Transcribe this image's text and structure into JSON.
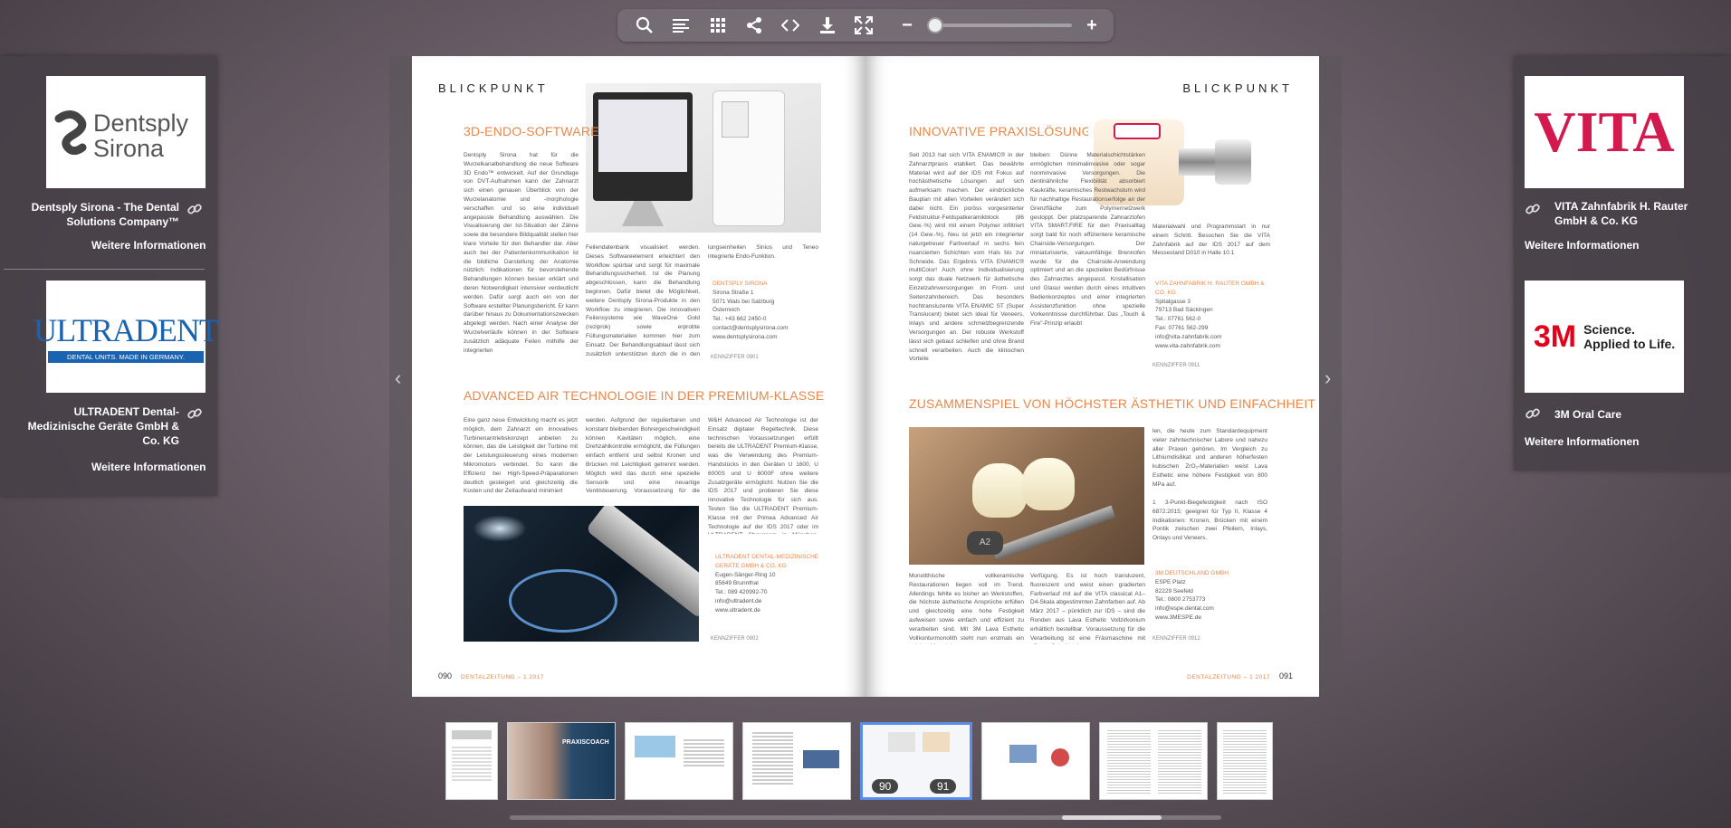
{
  "toolbar": {
    "buttons": [
      "search-icon",
      "toc-icon",
      "grid-icon",
      "share-icon",
      "embed-icon",
      "download-icon",
      "fullscreen-icon"
    ],
    "zoom_out": "−",
    "zoom_in": "+",
    "zoom_level": 0
  },
  "left_panel": {
    "sponsors": [
      {
        "logo_text_1": "Dentsply",
        "logo_text_2": "Sirona",
        "name": "Dentsply Sirona - The Dental Solutions Company™",
        "more": "Weitere Informationen"
      },
      {
        "logo_text_1": "ULTRADENT",
        "logo_text_2": "DENTAL UNITS. MADE IN GERMANY.",
        "name": "ULTRADENT Dental-Medizinische Geräte GmbH & Co. KG",
        "more": "Weitere Informationen"
      }
    ]
  },
  "right_panel": {
    "sponsors": [
      {
        "logo_text_1": "VITA",
        "name": "VITA Zahnfabrik H. Rauter GmbH & Co. KG",
        "more": "Weitere Informationen"
      },
      {
        "logo_text_1": "3M",
        "logo_text_2": "Science.",
        "logo_text_3": "Applied to Life.",
        "name": "3M Oral Care",
        "more": "Weitere Informationen"
      }
    ]
  },
  "left_page": {
    "kicker": "BLICKPUNKT",
    "headline_1": "3D-ENDO-SOFTWARE",
    "body_1a": "Dentsply Sirona hat für die Wurzelkanalbehandlung die neue Software 3D Endo™ entwickelt. Auf der Grundlage von DVT-Aufnahmen kann der Zahnarzt sich einen genauen Überblick von der Wurzelanatomie und -morphologie verschaffen und so eine individuell angepasste Behandlung auswählen. Die Visualisierung der Ist-Situation der Zähne sowie die besondere Bildqualität stellen hier klare Vorteile für den Behandler dar. Aber auch bei der Patientenkommunikation ist die bildliche Darstellung der Anatomie nützlich: Indikationen für bevorstehende Behandlungen können besser erklärt und deren Notwendigkeit intensiver verdeutlicht werden. Dafür sorgt auch ein von der Software erstellter Planungsbericht. Er kann darüber hinaus zu Dokumentationszwecken abgelegt werden. Nach einer Analyse der Wurzelverläufe können in der Software zusätzlich adäquate Feilen mithilfe der integrierten",
    "body_1b": "Feilendatenbank visualisiert werden. Dieses Softwareelement erleichtert den Workflow spürbar und sorgt für maximale Behandlungssicherheit. Ist die Planung abgeschlossen, kann die Behandlung beginnen. Dafür bietet die Möglichkeit, weitere Dentsply Sirona-Produkte in den Workflow zu integrieren. Die innovativen Feilensysteme wie WaveOne Gold (reziprok) sowie erprobte Füllungsmaterialien kommen hier zum Einsatz. Der Behandlungsablauf lässt sich zusätzlich unterstützen durch die in den Behand-",
    "body_1c": "lungseinheiten Sinius und Teneo integrierte Endo-Funktion.",
    "contact_1_co": "DENTSPLY SIRONA",
    "contact_1": [
      "Sirona Straße 1",
      "5071 Wals bei Salzburg",
      "Österreich",
      "Tel.: +43 662 2450-0",
      "contact@dentsplysirona.com",
      "www.dentsplysirona.com"
    ],
    "kennz_1": "KENNZIFFER 0901",
    "headline_2": "ADVANCED AIR TECHNOLOGIE IN DER PREMIUM-KLASSE",
    "body_2a": "Eine ganz neue Entwicklung macht es jetzt möglich, dem Zahnarzt ein innovatives Turbinenantriebskonzept anbieten zu können, das die Leistigkeit der Turbine mit der Leistungssteuerung eines modernen Mikromotors verbindet. So kann die Effizienz bei High-Speed-Präparationen deutlich gesteigert und gleichzeitig die Kosten und der Zeitaufwand minimiert",
    "body_2b": "werden. Aufgrund der regulierbaren und konstant bleibenden Bohrergeschwindigkeit können Kavitäten möglich, eine Drehzahlkontrolle ermöglicht, die Füllungen einfach entfernt und selbst Kronen und Brücken mit Leichtigkeit getrennt werden. Möglich wird das durch eine spezielle Sensorik und eine neuartige Ventilsteuerung. Voraussetzung für die Nutzung der",
    "body_2c": "W&H Advanced Air Technologie ist der Einsatz digitaler Regeltechnik. Diese technischen Voraussetzungen erfüllt bereits die ULTRADENT Premium-Klasse, was die Verwendung des Premium-Handstücks in den Geräten U 1600, U 6000S und U 6000F ohne weitere Zusatzgeräte ermöglicht. Nutzen Sie die IDS 2017 und probieren Sie diese innovative Technologie für sich aus. Testen Sie die ULTRADENT Premium-Klasse mit der Primea Advanced Air Technologie auf der IDS 2017 oder im ULTRADENT Showroom in München-Brunnthal.",
    "contact_2_co": "ULTRADENT DENTAL-MEDIZINISCHE GERÄTE GMBH & CO. KG",
    "contact_2": [
      "Eugen-Sänger-Ring 10",
      "85649 Brunnthal",
      "Tel.: 089 420992-70",
      "info@ultradent.de",
      "www.ultradent.de"
    ],
    "kennz_2": "KENNZIFFER 0902",
    "page_no": "090",
    "magazine": "DENTALZEITUNG – 1 2017"
  },
  "right_page": {
    "kicker": "BLICKPUNKT",
    "headline_1": "INNOVATIVE PRAXISLÖSUNGEN",
    "body_1a": "Seit 2013 hat sich VITA ENAMIC® in der Zahnarztpraxis etabliert. Das bewährte Material wird auf der IDS mit Fokus auf hochästhetische Lösungen auf sich aufmerksam machen. Der eindrückliche Bauplan mit allen Vorteilen verändert sich dabei nicht. Ein poröss vorgesinterter Feldstruktur-Feldspatkeramikblock (86 Gew.-%) wird mit einem Polymer infiltriert (14 Gew.-%). Neu ist jetzt ein integrierter naturgetreuer Farbverlauf in sechs fein nuancierten Schichten vom Hals bis zur Schneide. Das Ergebnis VITA ENAMIC® multiColor! Auch ohne Individualisierung sorgt das duale Netzwerk für ästhetische Einzelzahnversorgungen im Front- und Seitenzahnbereich. Das besonders hochtransluzente VITA ENAMIC ST (Super Translucent) bietet sich ideal für Veneers, Inlays und andere schmelzbegrenzende Versorgungen an. Der robuste Werkstoff lässt sich gebaut schleifen und ohne Brand schnell verarbeiten. Auch die klinischen Vorteile",
    "body_1b": "bleiben: Dünne Materialschichtstärken ermöglichen minimalinvasive oder sogar nonminvasive Versorgungen. Die dentinähnliche Flexibilität absorbiert Kaukräfte, keramisches Restwachstum wird für nachhaltige Restaurationserfolge an der Grenzfläche zum Polymernetzwerk gestoppt. Der platzsparende Zahnarztofen VITA SMART.FIRE für den Praxisalltag sorgt bald für noch effizientere keramische Chairside-Versorgungen. Der miniaturisierte, vakuumfähige Brennofen wurde für die Chairside-Anwendung optimiert und an die speziellen Bedürfnisse des Zahnarztes angepasst. Kristallisation und Glasur werden durch eines intuitiven Bedienkonzeptes und einer integrierten Assistenzfunktion ohne spezielle Vorkenntnisse durchführbar. Das „Touch & Fire\"-Prinzip erlaubt",
    "body_1c": "Materialwahl und Programmstart in nur einem Schritt. Besuchen Sie die VITA Zahnfabrik auf der IDS 2017 auf dem Messestand D010 in Halle 10.1",
    "contact_1_co": "VITA ZAHNFABRIK H. RAUTER GMBH & CO. KG",
    "contact_1": [
      "Spitalgasse 3",
      "79713 Bad Säckingen",
      "Tel.: 07761 562-0",
      "Fax: 07761 562-299",
      "info@vita-zahnfabrik.com",
      "www.vita-zahnfabrik.com"
    ],
    "kennz_1": "KENNZIFFER 0911",
    "headline_2": "ZUSAMMENSPIEL VON HÖCHSTER ÄSTHETIK UND EINFACHHEIT",
    "body_2_side": "len, die heute zum Standardequipment vieler zahntechnischer Labore und nahezu aller Praxen gehören. Im Vergleich zu Lithiumdisilikat und anderen höherfesten kubischen ZrO₂-Materialien weist Lava Esthetic eine höhere Festigkeit von 800 MPa auf.",
    "body_2_note": "1 3-Punkt-Biegefestigkeit nach ISO 6872:2015; geeignet für Typ II, Klasse 4 Indikationen: Kronen, Brücken mit einem Pontik zwischen zwei Pfeilern, Inlays, Onlays und Veneers.",
    "body_2a": "Monolithische vollkeramische Restaurationen liegen voll im Trend. Allerdings fehlte es bisher an Werkstoffen, die höchste ästhetische Ansprüche erfüllen und gleichzeitig eine hohe Festigkeit aufweisen sowie einfach und effizient zu verarbeiten sind. Mit 3M Lava Esthetic Vollkonturmonolith steht nun erstmals ein solches Material zur",
    "body_2b": "Verfügung. Es ist hoch transluzent, fluoreszent und weist einen gradierten Farbverlauf mit auf die VITA classical A1–D4-Skala abgestimmten Zahnfarben auf. Ab März 2017 – pünktlich zur IDS – sind die Ronden aus Lava Esthetic Vollzirkonium erhältlich bestellbar. Voraussetzung für die Verarbeitung ist eine Fräsmaschine mit offenen Schnittstel-",
    "contact_2_co": "3M DEUTSCHLAND GMBH",
    "contact_2": [
      "ESPE Platz",
      "82229 Seefeld",
      "Tel.: 0800 2753773",
      "info@espe.dental.com",
      "www.3MESPE.de"
    ],
    "kennz_2": "KENNZIFFER 0912",
    "page_no": "091",
    "magazine": "DENTALZEITUNG – 1 2017"
  },
  "thumbnails": {
    "pages_active": [
      "90",
      "91"
    ],
    "cover_text": "PRAXISCOACH"
  }
}
